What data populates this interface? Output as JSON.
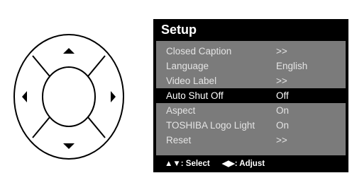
{
  "dpad": {
    "buttons": [
      "up",
      "down",
      "left",
      "right"
    ]
  },
  "menu": {
    "title": "Setup",
    "selected_index": 3,
    "items": [
      {
        "label": "Closed Caption",
        "value": ">>"
      },
      {
        "label": "Language",
        "value": "English"
      },
      {
        "label": "Video Label",
        "value": ">>"
      },
      {
        "label": "Auto Shut Off",
        "value": "Off"
      },
      {
        "label": "Aspect",
        "value": "On"
      },
      {
        "label": "TOSHIBA Logo Light",
        "value": "On"
      },
      {
        "label": "Reset",
        "value": ">>"
      }
    ],
    "footer": {
      "select_hint": "▲▼: Select",
      "adjust_hint": "◀▶: Adjust"
    }
  },
  "colors": {
    "panel": "#000000",
    "menu_background": "#7b7b7b",
    "highlight": "#000000",
    "text": "#e4e4e4"
  }
}
